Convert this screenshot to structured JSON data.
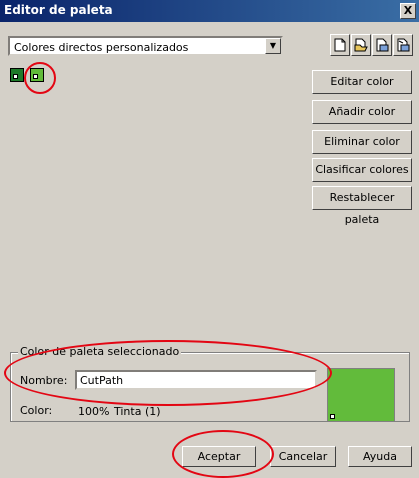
{
  "window": {
    "title": "Editor de paleta",
    "close": "X"
  },
  "palette_select": {
    "value": "Colores directos personalizados"
  },
  "toolbar": {
    "icons": [
      "new-palette-icon",
      "open-palette-icon",
      "save-palette-icon",
      "save-as-palette-icon"
    ]
  },
  "swatches": [
    {
      "color": "#1e7a2a",
      "selected": false
    },
    {
      "color": "#62bb3b",
      "selected": true
    }
  ],
  "side_buttons": {
    "edit": "Editar color",
    "add": "Añadir color",
    "delete": "Eliminar color",
    "sort": "Clasificar colores",
    "reset": "Restablecer paleta"
  },
  "selected_color": {
    "group_label": "Color de paleta seleccionado",
    "name_label": "Nombre:",
    "name_value": "CutPath",
    "color_label": "Color:",
    "percent": "100%",
    "type": "Tinta (1)",
    "swatch_color": "#62bb3b"
  },
  "footer": {
    "ok": "Aceptar",
    "cancel": "Cancelar",
    "help": "Ayuda"
  },
  "annotation_color": "#e30613"
}
